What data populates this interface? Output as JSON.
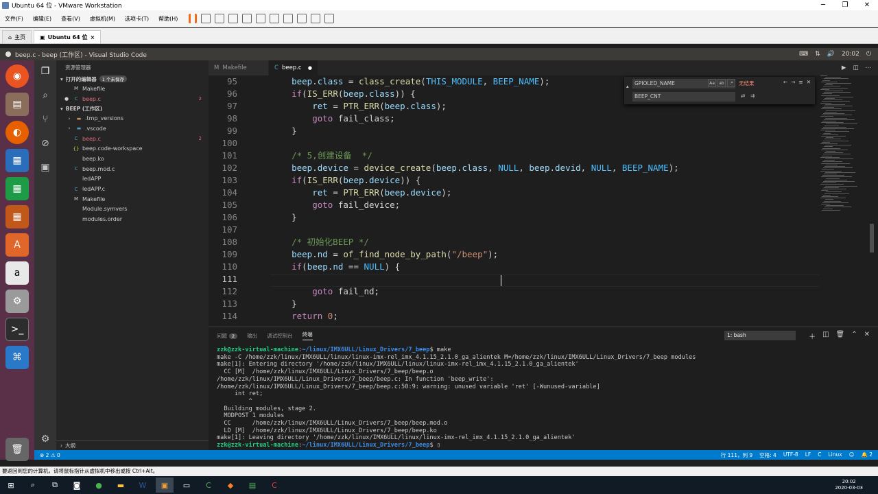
{
  "vmware": {
    "title": "Ubuntu 64 位 - VMware Workstation",
    "menu": [
      "文件(F)",
      "编辑(E)",
      "查看(V)",
      "虚拟机(M)",
      "选项卡(T)",
      "帮助(H)"
    ],
    "tabs": [
      "主页",
      "Ubuntu 64 位"
    ],
    "status_message": "要返回到您的计算机，请将鼠标指针从虚拟机中移出或按 Ctrl+Alt。"
  },
  "ubuntu": {
    "window_title": "beep.c - beep (工作区) - Visual Studio Code",
    "clock": "20:02"
  },
  "sidebar": {
    "title": "资源管理器",
    "open_editors_label": "打开的编辑器",
    "unsaved_badge": "1 个未保存",
    "open_editors": [
      {
        "name": "Makefile",
        "icon": "M",
        "count": ""
      },
      {
        "name": "beep.c",
        "icon": "C",
        "count": "2"
      }
    ],
    "workspace_label": "BEEP (工作区)",
    "files": [
      {
        "name": ".tmp_versions",
        "icon": "folder",
        "count": ""
      },
      {
        "name": ".vscode",
        "icon": "folder",
        "count": ""
      },
      {
        "name": "beep.c",
        "icon": "C",
        "count": "2"
      },
      {
        "name": "beep.code-workspace",
        "icon": "{}",
        "count": ""
      },
      {
        "name": "beep.ko",
        "icon": "file",
        "count": ""
      },
      {
        "name": "beep.mod.c",
        "icon": "C",
        "count": ""
      },
      {
        "name": "ledAPP",
        "icon": "file",
        "count": ""
      },
      {
        "name": "ledAPP.c",
        "icon": "C",
        "count": ""
      },
      {
        "name": "Makefile",
        "icon": "M",
        "count": ""
      },
      {
        "name": "Module.symvers",
        "icon": "file",
        "count": ""
      },
      {
        "name": "modules.order",
        "icon": "file",
        "count": ""
      }
    ],
    "outline_label": "大纲"
  },
  "editor": {
    "tabs": [
      "Makefile",
      "beep.c"
    ],
    "lines": [
      {
        "n": "95",
        "html": "    <span class='mem'>beep</span>.<span class='mem'>class</span> = <span class='fn'>class_create</span>(<span class='mac'>THIS_MODULE</span>, <span class='mac'>BEEP_NAME</span>);"
      },
      {
        "n": "96",
        "html": "    <span class='kw'>if</span>(<span class='fn'>IS_ERR</span>(<span class='mem'>beep</span>.<span class='mem'>class</span>)) {"
      },
      {
        "n": "97",
        "html": "        <span class='mem'>ret</span> = <span class='fn'>PTR_ERR</span>(<span class='mem'>beep</span>.<span class='mem'>class</span>);"
      },
      {
        "n": "98",
        "html": "        <span class='kw'>goto</span> fail_class;"
      },
      {
        "n": "99",
        "html": "    }"
      },
      {
        "n": "100",
        "html": ""
      },
      {
        "n": "101",
        "html": "    <span class='cm'>/* 5,创建设备  */</span>"
      },
      {
        "n": "102",
        "html": "    <span class='mem'>beep</span>.<span class='mem'>device</span> = <span class='fn'>device_create</span>(<span class='mem'>beep</span>.<span class='mem'>class</span>, <span class='mac'>NULL</span>, <span class='mem'>beep</span>.<span class='mem'>devid</span>, <span class='mac'>NULL</span>, <span class='mac'>BEEP_NAME</span>);"
      },
      {
        "n": "103",
        "html": "    <span class='kw'>if</span>(<span class='fn'>IS_ERR</span>(<span class='mem'>beep</span>.<span class='mem'>device</span>)) {"
      },
      {
        "n": "104",
        "html": "        <span class='mem'>ret</span> = <span class='fn'>PTR_ERR</span>(<span class='mem'>beep</span>.<span class='mem'>device</span>);"
      },
      {
        "n": "105",
        "html": "        <span class='kw'>goto</span> fail_device;"
      },
      {
        "n": "106",
        "html": "    }"
      },
      {
        "n": "107",
        "html": ""
      },
      {
        "n": "108",
        "html": "    <span class='cm'>/* 初始化BEEP */</span>"
      },
      {
        "n": "109",
        "html": "    <span class='mem'>beep</span>.<span class='mem'>nd</span> = <span class='fn'>of_find_node_by_path</span>(<span class='str'>\"/beep\"</span>);"
      },
      {
        "n": "110",
        "html": "    <span class='kw'>if</span>(<span class='mem'>beep</span>.<span class='mem'>nd</span> == <span class='mac'>NULL</span>) {"
      },
      {
        "n": "111",
        "html": ""
      },
      {
        "n": "112",
        "html": "        <span class='kw'>goto</span> fail_nd;"
      },
      {
        "n": "113",
        "html": "    }"
      },
      {
        "n": "114",
        "html": "    <span class='kw'>return</span> <span class='str'>0</span>;"
      }
    ]
  },
  "find": {
    "query": "GPIOLED_NAME",
    "no_results": "无结果",
    "replace": "BEEP_CNT",
    "match_case": "Aa",
    "whole_word": "ab",
    "regex": ".*"
  },
  "panel": {
    "tabs": [
      "问题",
      "输出",
      "调试控制台",
      "终端"
    ],
    "problems_count": "2",
    "terminal_select": "1: bash",
    "lines": [
      "<span class='prompt'>zzk@zzk-virtual-machine</span>:<span class='path'>~/linux/IMX6ULL/Linux_Drivers/7_beep</span>$ make",
      "make -C /home/zzk/linux/IMX6ULL/linux/linux-imx-rel_imx_4.1.15_2.1.0_ga_alientek M=/home/zzk/linux/IMX6ULL/Linux_Drivers/7_beep modules",
      "make[1]: Entering directory '/home/zzk/linux/IMX6ULL/linux/linux-imx-rel_imx_4.1.15_2.1.0_ga_alientek'",
      "  CC [M]  /home/zzk/linux/IMX6ULL/Linux_Drivers/7_beep/beep.o",
      "/home/zzk/linux/IMX6ULL/Linux_Drivers/7_beep/beep.c: In function 'beep_write':",
      "/home/zzk/linux/IMX6ULL/Linux_Drivers/7_beep/beep.c:50:9: warning: unused variable 'ret' [-Wunused-variable]",
      "     int ret;",
      "         ^",
      "  Building modules, stage 2.",
      "  MODPOST 1 modules",
      "  CC      /home/zzk/linux/IMX6ULL/Linux_Drivers/7_beep/beep.mod.o",
      "  LD [M]  /home/zzk/linux/IMX6ULL/Linux_Drivers/7_beep/beep.ko",
      "make[1]: Leaving directory '/home/zzk/linux/IMX6ULL/linux/linux-imx-rel_imx_4.1.15_2.1.0_ga_alientek'",
      "<span class='prompt'>zzk@zzk-virtual-machine</span>:<span class='path'>~/linux/IMX6ULL/Linux_Drivers/7_beep</span>$ ▯"
    ]
  },
  "statusbar": {
    "errors": "2",
    "warnings": "0",
    "position": "行 111，列 9",
    "spaces": "空格: 4",
    "encoding": "UTF-8",
    "eol": "LF",
    "language": "C",
    "os": "Linux",
    "notifications": "2"
  },
  "taskbar": {
    "time": "20:02",
    "date": "2020-03-03"
  }
}
